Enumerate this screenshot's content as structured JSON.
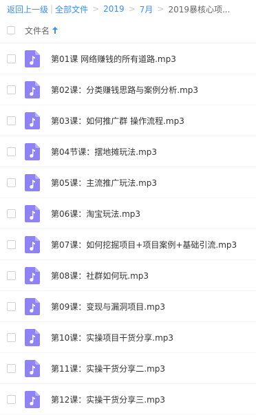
{
  "breadcrumb": {
    "back_label": "返回上一级",
    "all_files_label": "全部文件",
    "separator": ">",
    "pipe": "|",
    "items": [
      "2019",
      "7月"
    ],
    "current": "2019暴核心项..."
  },
  "list_header": {
    "column_label": "文件名",
    "sort_direction": "ascending",
    "sort_icon": "arrow-up-icon"
  },
  "colors": {
    "accent": "#3b8cff",
    "audio_icon": "#8f82f5"
  },
  "files": [
    {
      "name": "第01课 网络赚钱的所有道路.mp3",
      "icon": "audio-file-icon"
    },
    {
      "name": "第02课：分类赚钱思路与案例分析.mp3",
      "icon": "audio-file-icon"
    },
    {
      "name": "第03课：如何推广群 操作流程.mp3",
      "icon": "audio-file-icon"
    },
    {
      "name": "第04节课：摆地摊玩法.mp3",
      "icon": "audio-file-icon"
    },
    {
      "name": "第05课：主流推广玩法.mp3",
      "icon": "audio-file-icon"
    },
    {
      "name": "第06课：淘宝玩法.mp3",
      "icon": "audio-file-icon"
    },
    {
      "name": "第07课：如何挖掘项目+项目案例+基础引流.mp3",
      "icon": "audio-file-icon"
    },
    {
      "name": "第08课：社群如何玩.mp3",
      "icon": "audio-file-icon"
    },
    {
      "name": "第09课：变现与漏洞项目.mp3",
      "icon": "audio-file-icon"
    },
    {
      "name": "第10课：实操项目干货分享.mp3",
      "icon": "audio-file-icon"
    },
    {
      "name": "第11课：实操干货分享二.mp3",
      "icon": "audio-file-icon"
    },
    {
      "name": "第12课：实操干货分享三.mp3",
      "icon": "audio-file-icon"
    }
  ]
}
